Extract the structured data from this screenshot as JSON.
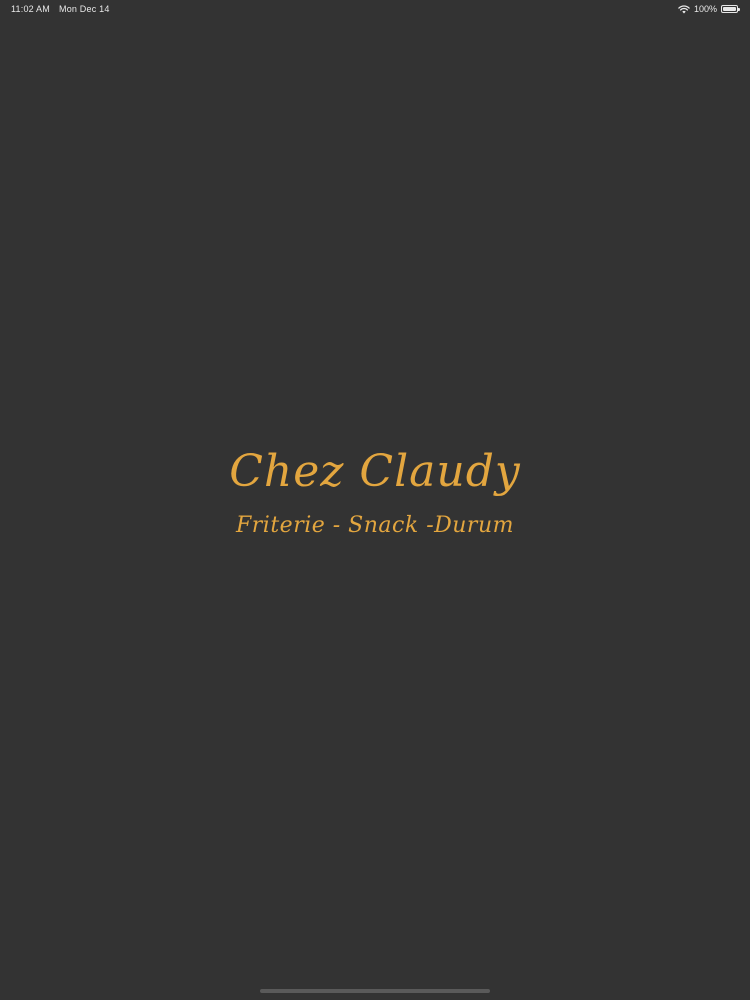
{
  "status_bar": {
    "time": "11:02 AM",
    "date": "Mon Dec 14",
    "battery_percent": "100%",
    "battery_level": 1.0,
    "icons": [
      "wifi-icon",
      "battery-icon"
    ]
  },
  "brand": {
    "name": "Chez Claudy",
    "tagline": "Friterie - Snack -Durum"
  },
  "colors": {
    "background": "#333333",
    "accent": "#e3a63f",
    "status_text": "#e8e8e8",
    "home_indicator": "#5a5a5a"
  }
}
